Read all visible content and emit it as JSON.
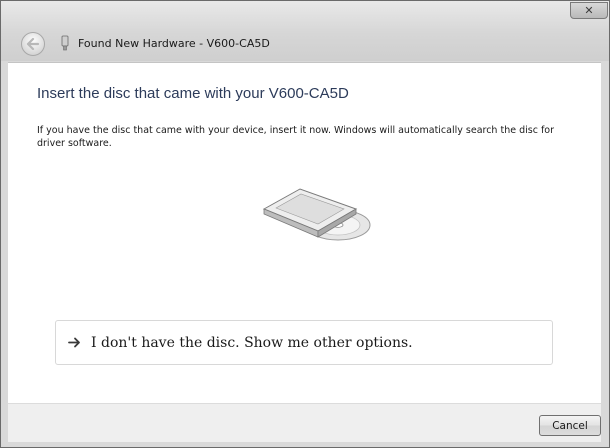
{
  "window": {
    "title": "Found New Hardware - V600-CA5D",
    "close_glyph": "✕"
  },
  "content": {
    "heading": "Insert the disc that came with your V600-CA5D",
    "description": "If you have the disc that came with your device, insert it now.  Windows will automatically search the disc for driver software.",
    "illustration_icon": "disc-drive-icon"
  },
  "option": {
    "label": "I don't have the disc.  Show me other options.",
    "icon": "arrow-right-icon"
  },
  "footer": {
    "cancel_label": "Cancel"
  },
  "icons": {
    "back": "back-arrow-icon",
    "device": "usb-device-icon",
    "close": "close-icon"
  }
}
